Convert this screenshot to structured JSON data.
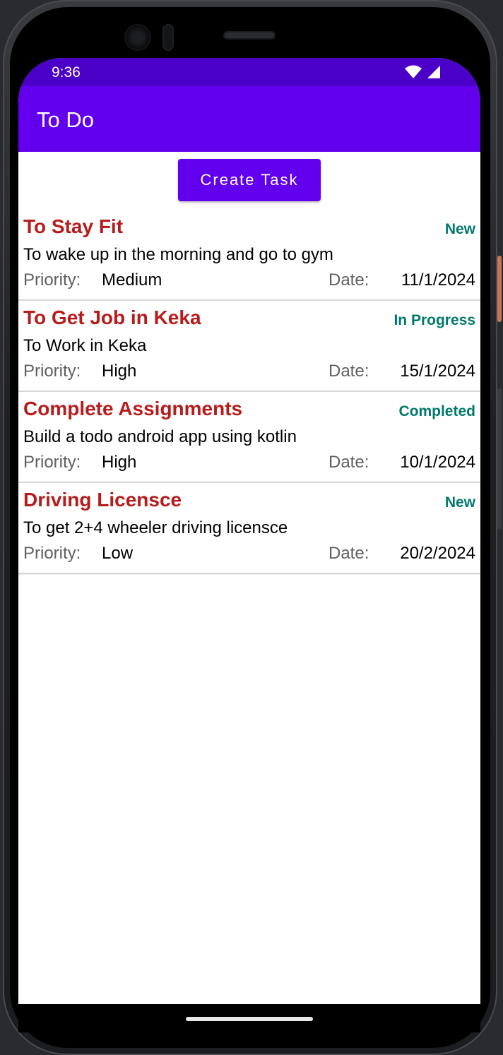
{
  "status_bar": {
    "time": "9:36",
    "icons": [
      "wifi-icon",
      "signal-icon"
    ]
  },
  "app_bar": {
    "title": "To Do"
  },
  "create_button": {
    "label": "Create Task"
  },
  "task_labels": {
    "priority": "Priority:",
    "date": "Date:"
  },
  "tasks": [
    {
      "title": "To Stay Fit",
      "status": "New",
      "description": "To wake up in the morning and go to gym",
      "priority": "Medium",
      "date": "11/1/2024"
    },
    {
      "title": "To Get Job in Keka",
      "status": "In Progress",
      "description": "To Work in Keka",
      "priority": "High",
      "date": "15/1/2024"
    },
    {
      "title": "Complete Assignments",
      "status": "Completed",
      "description": "Build a todo android app using kotlin",
      "priority": "High",
      "date": "10/1/2024"
    },
    {
      "title": "Driving Licensce",
      "status": "New",
      "description": "To get 2+4 wheeler driving licensce",
      "priority": "Low",
      "date": "20/2/2024"
    }
  ],
  "colors": {
    "primary": "#6200ee",
    "primary_dark": "#4a00c7",
    "task_title": "#b71c1c",
    "task_status": "#00796b"
  }
}
